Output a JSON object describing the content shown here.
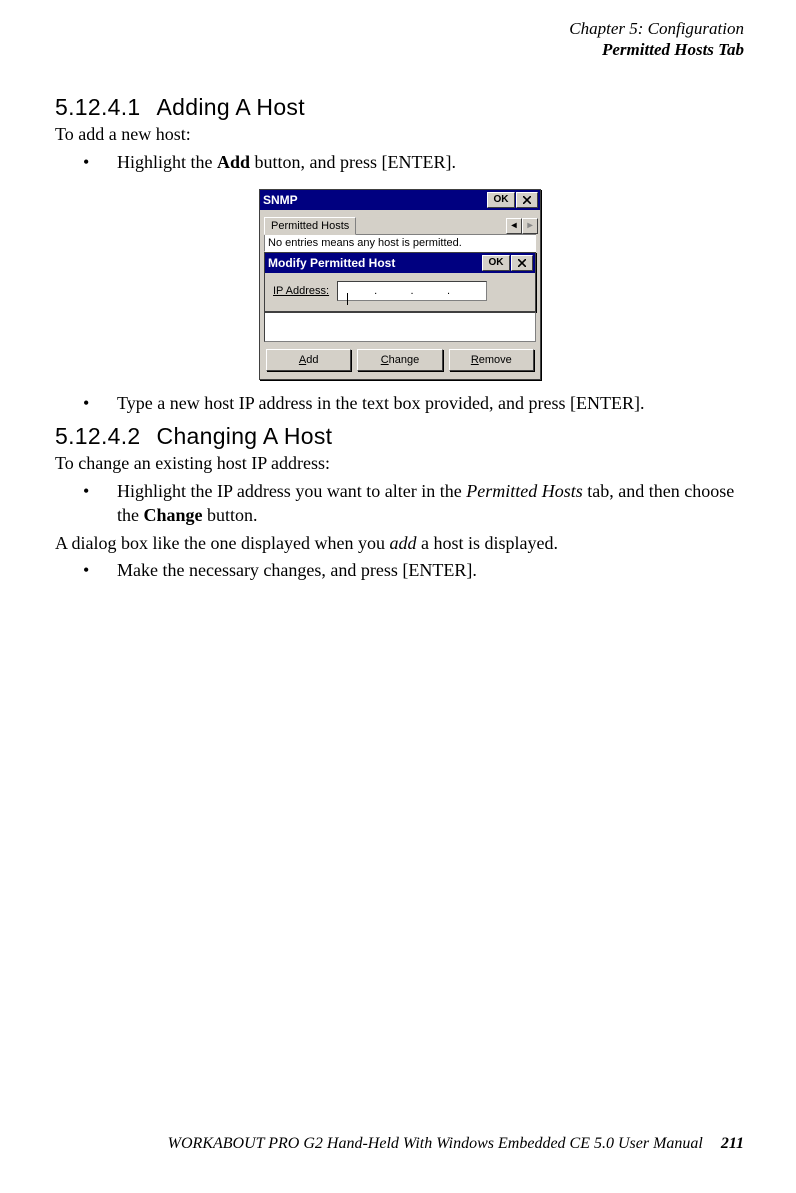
{
  "header": {
    "chapter": "Chapter 5: Configuration",
    "subtitle": "Permitted Hosts Tab"
  },
  "section1": {
    "num": "5.12.4.1",
    "title": "Adding A Host",
    "intro": "To add a new host:",
    "bullet1a": "Highlight the ",
    "bullet1_bold": "Add",
    "bullet1b": " button, and press [ENTER].",
    "bullet2": "Type a new host IP address in the text box provided, and press [ENTER]."
  },
  "section2": {
    "num": "5.12.4.2",
    "title": "Changing A Host",
    "intro": "To change an existing host IP address:",
    "bullet1a": "Highlight the IP address you want to alter in the ",
    "bullet1_ital": "Permitted Hosts",
    "bullet1b": " tab, and then choose the ",
    "bullet1_bold": "Change",
    "bullet1c": " button.",
    "p2a": "A dialog box like the one displayed when you ",
    "p2_ital": "add",
    "p2b": " a host is displayed.",
    "bullet2": "Make the necessary changes, and press [ENTER]."
  },
  "figure": {
    "win_title": "SNMP",
    "ok_label": "OK",
    "tab_label": "Permitted Hosts",
    "info_text": "No entries means any host is permitted.",
    "dialog_title": "Modify Permitted Host",
    "ip_label": "IP Address:",
    "ip_value": "",
    "dot": ".",
    "btn_add": "Add",
    "btn_add_u": "A",
    "btn_add_rest": "dd",
    "btn_change": "Change",
    "btn_change_u": "C",
    "btn_change_rest": "hange",
    "btn_remove": "Remove",
    "btn_remove_u": "R",
    "btn_remove_rest": "emove",
    "left_tri": "◂",
    "right_tri": "▸"
  },
  "footer": {
    "text": "WORKABOUT PRO G2 Hand-Held With Windows Embedded CE 5.0 User Manual",
    "page": "211"
  }
}
